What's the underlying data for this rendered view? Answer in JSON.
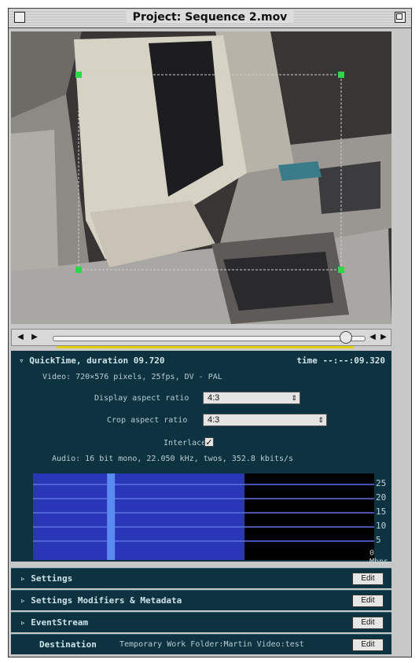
{
  "window": {
    "title": "Project: Sequence 2.mov"
  },
  "player": {
    "controls": {
      "volume_icon": "speaker-icon",
      "play_icon": "play-icon",
      "step_back_icon": "step-back-icon",
      "step_forward_icon": "step-forward-icon"
    },
    "position": 0.94
  },
  "source": {
    "title": "QuickTime, duration 09.720",
    "time_label": "time --:--:09.320",
    "video_info": "Video: 720×576 pixels, 25fps, DV - PAL",
    "display_aspect_label": "Display aspect ratio",
    "display_aspect_value": "4:3",
    "crop_aspect_label": "Crop aspect ratio",
    "crop_aspect_value": "4:3",
    "interlaced_label": "Interlaced",
    "interlaced_checked": true,
    "audio_info": "Audio: 16 bit mono, 22.050 kHz, twos, 352.8 kbits/s"
  },
  "chart_data": {
    "type": "area",
    "y_unit": "Mbps",
    "y_ticks": [
      "25",
      "20",
      "15",
      "10",
      "5",
      "0 Mbps"
    ],
    "ylim": [
      0,
      25
    ],
    "fill_color": "#2a36b8",
    "band_level_fraction": 0.62,
    "highlight_position_fraction": 0.5
  },
  "sections": [
    {
      "label": "Settings",
      "edit": "Edit"
    },
    {
      "label": "Settings Modifiers & Metadata",
      "edit": "Edit"
    },
    {
      "label": "EventStream",
      "edit": "Edit"
    },
    {
      "label": "Destination",
      "path": "Temporary Work Folder:Martin Video:test",
      "edit": "Edit"
    }
  ],
  "colors": {
    "panel_bg": "#0d3340",
    "handle_green": "#2bd84a",
    "accent_yellow": "#e3d000"
  }
}
